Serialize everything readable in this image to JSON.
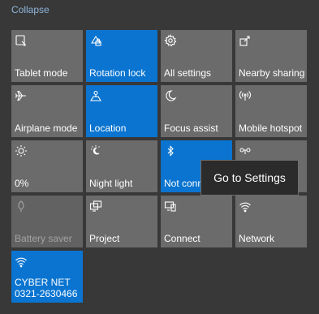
{
  "header": {
    "collapse_label": "Collapse"
  },
  "tiles": [
    {
      "label": "Tablet mode",
      "state": "off",
      "icon": "tablet-mode-icon"
    },
    {
      "label": "Rotation lock",
      "state": "on",
      "icon": "rotation-lock-icon"
    },
    {
      "label": "All settings",
      "state": "off",
      "icon": "gear-icon"
    },
    {
      "label": "Nearby sharing",
      "state": "off",
      "icon": "nearby-sharing-icon"
    },
    {
      "label": "Airplane mode",
      "state": "off",
      "icon": "airplane-icon"
    },
    {
      "label": "Location",
      "state": "on",
      "icon": "location-icon"
    },
    {
      "label": "Focus assist",
      "state": "off",
      "icon": "moon-icon"
    },
    {
      "label": "Mobile hotspot",
      "state": "off",
      "icon": "hotspot-icon"
    },
    {
      "label": "0%",
      "state": "off",
      "icon": "brightness-icon"
    },
    {
      "label": "Night light",
      "state": "off",
      "icon": "night-light-icon"
    },
    {
      "label": "Not conn",
      "state": "on",
      "icon": "bluetooth-icon"
    },
    {
      "label": "",
      "state": "off",
      "icon": "project-icon"
    },
    {
      "label": "Battery saver",
      "state": "disabled",
      "icon": "battery-saver-icon"
    },
    {
      "label": "Project",
      "state": "off",
      "icon": "project-icon"
    },
    {
      "label": "Connect",
      "state": "off",
      "icon": "connect-icon"
    },
    {
      "label": "Network",
      "state": "off",
      "icon": "network-icon"
    }
  ],
  "network_tile": {
    "line1": "CYBER NET",
    "line2": "0321-2630466",
    "state": "on",
    "icon": "wifi-icon"
  },
  "tooltip": {
    "label": "Go to Settings"
  },
  "colors": {
    "accent": "#0a74d0",
    "tile_off": "#6b6b6b",
    "background": "#383838"
  }
}
